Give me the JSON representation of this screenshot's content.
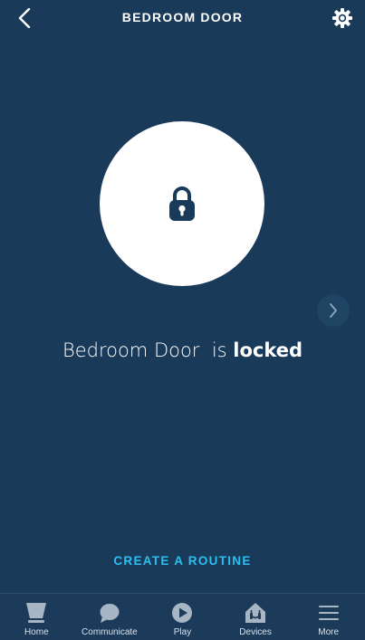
{
  "header": {
    "title": "BEDROOM DOOR",
    "back_icon": "chevron-left-icon",
    "settings_icon": "gear-icon"
  },
  "lock": {
    "icon": "padlock-icon",
    "device_name": "Bedroom Door",
    "connector": "is",
    "state": "locked"
  },
  "next_icon": "chevron-right-icon",
  "routine": {
    "label": "CREATE A ROUTINE"
  },
  "tabs": [
    {
      "label": "Home",
      "icon": "home-icon"
    },
    {
      "label": "Communicate",
      "icon": "chat-bubble-icon"
    },
    {
      "label": "Play",
      "icon": "play-icon"
    },
    {
      "label": "Devices",
      "icon": "devices-icon"
    },
    {
      "label": "More",
      "icon": "menu-icon"
    }
  ],
  "colors": {
    "background": "#1a3a5a",
    "accent": "#2ac0f0",
    "tab_icon": "#a7b5c4"
  }
}
